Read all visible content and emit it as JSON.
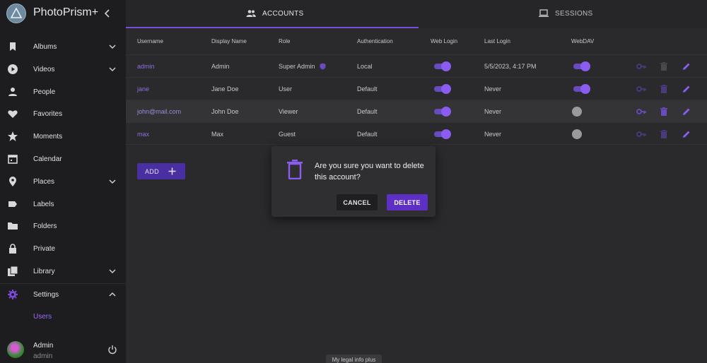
{
  "app": {
    "title": "PhotoPrism+"
  },
  "sidebar": {
    "items": [
      {
        "label": "Albums",
        "icon": "bookmark-icon",
        "expandable": true
      },
      {
        "label": "Videos",
        "icon": "play-circle-icon",
        "expandable": true
      },
      {
        "label": "People",
        "icon": "person-icon",
        "expandable": false
      },
      {
        "label": "Favorites",
        "icon": "heart-icon",
        "expandable": false
      },
      {
        "label": "Moments",
        "icon": "star-icon",
        "expandable": false
      },
      {
        "label": "Calendar",
        "icon": "calendar-icon",
        "expandable": false
      },
      {
        "label": "Places",
        "icon": "map-pin-icon",
        "expandable": true
      },
      {
        "label": "Labels",
        "icon": "label-icon",
        "expandable": false
      },
      {
        "label": "Folders",
        "icon": "folder-icon",
        "expandable": false
      },
      {
        "label": "Private",
        "icon": "lock-icon",
        "expandable": false
      },
      {
        "label": "Library",
        "icon": "library-icon",
        "expandable": true
      },
      {
        "label": "Settings",
        "icon": "gear-icon",
        "expandable": true,
        "expanded": true
      }
    ],
    "sub_item": "Users",
    "user": {
      "name": "Admin",
      "login": "admin"
    }
  },
  "tabs": [
    {
      "label": "ACCOUNTS",
      "icon": "people-icon",
      "active": true
    },
    {
      "label": "SESSIONS",
      "icon": "laptop-icon",
      "active": false
    }
  ],
  "table": {
    "headers": [
      "Username",
      "Display Name",
      "Role",
      "Authentication",
      "Web Login",
      "Last Login",
      "WebDAV"
    ],
    "rows": [
      {
        "username": "admin",
        "display_name": "Admin",
        "role": "Super Admin",
        "auth": "Local",
        "web_login": true,
        "last_login": "5/5/2023, 4:17 PM",
        "webdav": true
      },
      {
        "username": "jane",
        "display_name": "Jane Doe",
        "role": "User",
        "auth": "Default",
        "web_login": true,
        "last_login": "Never",
        "webdav": true
      },
      {
        "username": "john@mail.com",
        "display_name": "John Doe",
        "role": "Viewer",
        "auth": "Default",
        "web_login": true,
        "last_login": "Never",
        "webdav": false
      },
      {
        "username": "max",
        "display_name": "Max",
        "role": "Guest",
        "auth": "Default",
        "web_login": true,
        "last_login": "Never",
        "webdav": false
      }
    ]
  },
  "add_button": {
    "label": "ADD"
  },
  "dialog": {
    "message": "Are you sure you want to delete this account?",
    "cancel_label": "CANCEL",
    "delete_label": "DELETE"
  },
  "footer": {
    "legal": "My legal info plus"
  },
  "colors": {
    "accent": "#7a4bdc",
    "link": "#8d6ee0",
    "sidebar_bg": "#1d1d1f",
    "main_bg": "#2a2a2c"
  }
}
